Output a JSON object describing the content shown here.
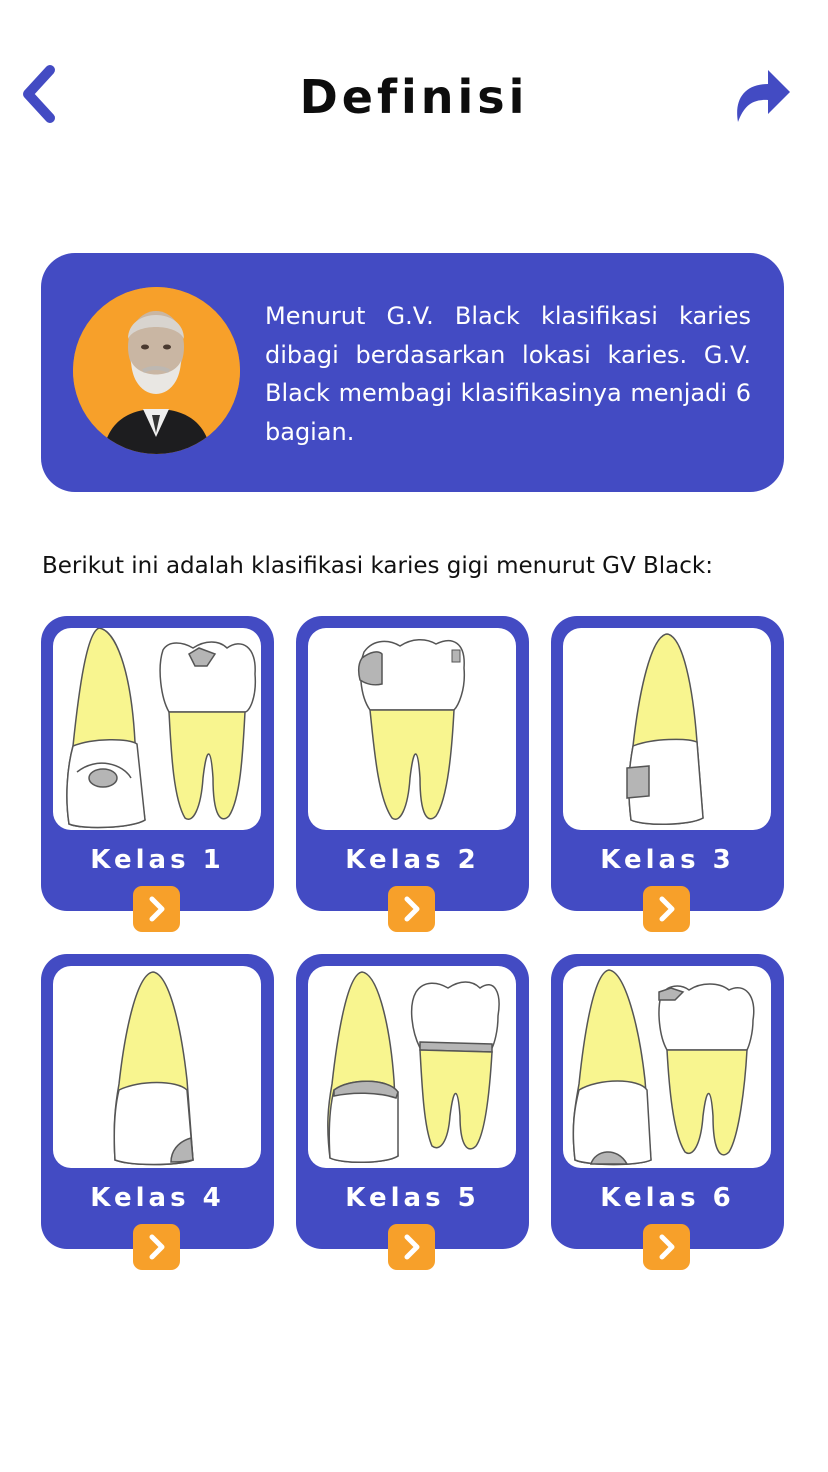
{
  "header": {
    "title": "Definisi",
    "back_icon": "chevron-left-icon",
    "share_icon": "share-arrow-icon"
  },
  "intro": {
    "text": "Menurut G.V. Black klasifikasi karies dibagi berdasarkan lokasi karies. G.V. Black membagi klasifikasinya menjadi 6 bagian.",
    "portrait_icon": "portrait-gv-black"
  },
  "list_intro": "Berikut ini adalah klasifikasi karies gigi menurut GV Black:",
  "classes": [
    {
      "label": "Kelas 1",
      "icon": "tooth-class-1-illustration"
    },
    {
      "label": "Kelas 2",
      "icon": "tooth-class-2-illustration"
    },
    {
      "label": "Kelas 3",
      "icon": "tooth-class-3-illustration"
    },
    {
      "label": "Kelas 4",
      "icon": "tooth-class-4-illustration"
    },
    {
      "label": "Kelas 5",
      "icon": "tooth-class-5-illustration"
    },
    {
      "label": "Kelas 6",
      "icon": "tooth-class-6-illustration"
    }
  ],
  "colors": {
    "primary": "#434bc3",
    "accent": "#f7a02a",
    "root_yellow": "#f8f58f",
    "caries_gray": "#b5b5b5"
  }
}
